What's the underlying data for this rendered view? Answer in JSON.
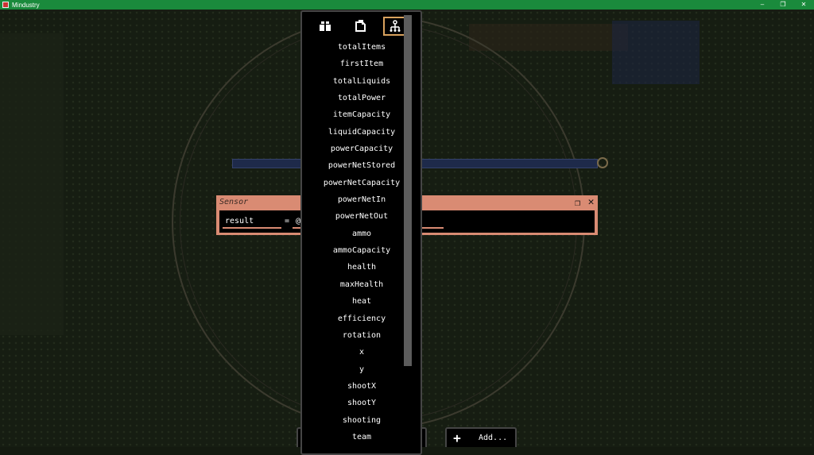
{
  "window": {
    "title": "Mindustry",
    "controls": [
      "–",
      "❐",
      "✕"
    ]
  },
  "colors": {
    "titlebar": "#1a8a3c",
    "sensor_accent": "#d98b73",
    "active_tab_border": "#d9a25e"
  },
  "sensor": {
    "title": "Sensor",
    "result_value": "result",
    "equals": "=",
    "target_value": "@"
  },
  "dropdown": {
    "tabs": [
      {
        "name": "items-tab-icon",
        "active": false
      },
      {
        "name": "liquids-tab-icon",
        "active": false
      },
      {
        "name": "properties-tab-icon",
        "active": true
      }
    ],
    "options": [
      "totalItems",
      "firstItem",
      "totalLiquids",
      "totalPower",
      "itemCapacity",
      "liquidCapacity",
      "powerCapacity",
      "powerNetStored",
      "powerNetCapacity",
      "powerNetIn",
      "powerNetOut",
      "ammo",
      "ammoCapacity",
      "health",
      "maxHealth",
      "heat",
      "efficiency",
      "rotation",
      "x",
      "y",
      "shootX",
      "shootY",
      "shooting",
      "team"
    ]
  },
  "bottom": {
    "left_button_label": "...",
    "add_label": "Add..."
  }
}
